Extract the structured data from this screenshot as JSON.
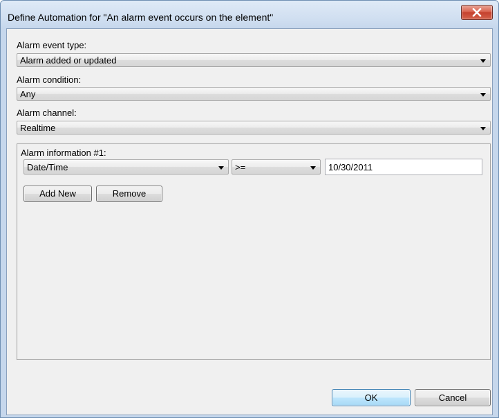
{
  "window": {
    "title": "Define Automation for \"An alarm event occurs on the element\""
  },
  "fields": {
    "event_type": {
      "label": "Alarm event type:",
      "value": "Alarm added or updated"
    },
    "condition": {
      "label": "Alarm condition:",
      "value": "Any"
    },
    "channel": {
      "label": "Alarm channel:",
      "value": "Realtime"
    }
  },
  "alarm_info": {
    "label": "Alarm information #1:",
    "field_value": "Date/Time",
    "operator_value": ">=",
    "value": "10/30/2011",
    "add_new_label": "Add New",
    "remove_label": "Remove"
  },
  "footer": {
    "ok_label": "OK",
    "cancel_label": "Cancel"
  },
  "icons": {
    "close": "close-icon",
    "dropdown": "chevron-down-icon"
  }
}
